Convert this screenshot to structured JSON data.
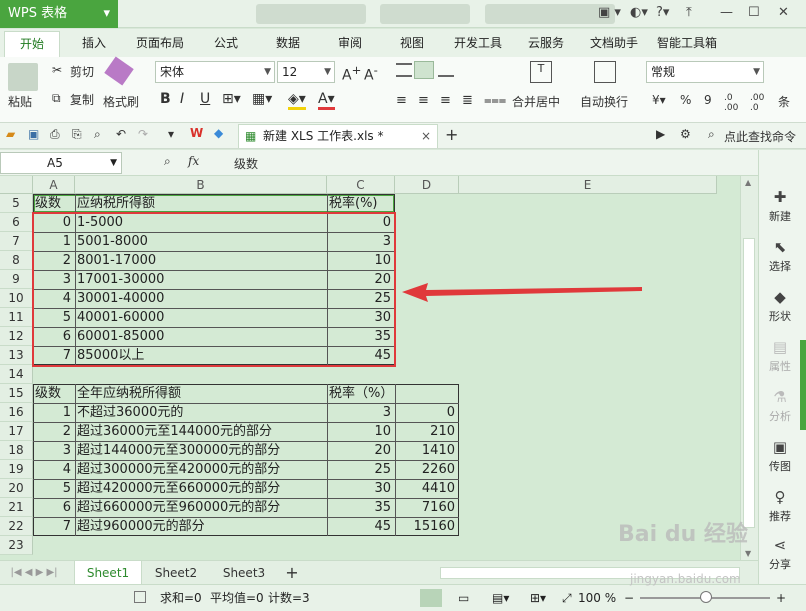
{
  "app": {
    "title": "WPS 表格",
    "title_dropdown": "▾"
  },
  "titlebar_icons": [
    "▣ ▾",
    "◐▾",
    "?▾",
    "⤒",
    "—",
    "☐",
    "✕"
  ],
  "menu": {
    "items": [
      "开始",
      "插入",
      "页面布局",
      "公式",
      "数据",
      "审阅",
      "视图",
      "开发工具",
      "云服务",
      "文档助手",
      "智能工具箱"
    ],
    "active": 0
  },
  "ribbon": {
    "paste": "粘贴",
    "cut": "剪切",
    "copy": "复制",
    "format_painter": "格式刷",
    "font": "宋体",
    "font_size": "12",
    "bold": "B",
    "italic": "I",
    "underline": "U",
    "merge": "合并居中",
    "wrap": "自动换行",
    "number_format": "常规",
    "percent": "%",
    "thousands": "9",
    "more": "条"
  },
  "quickbar": {
    "doc_tab": "新建 XLS 工作表.xls *",
    "search": "点此查找命令"
  },
  "formula": {
    "name_box": "A5",
    "fx": "fx",
    "content": "级数"
  },
  "columns": [
    "A",
    "B",
    "C",
    "D",
    "E"
  ],
  "rows": [
    "5",
    "6",
    "7",
    "8",
    "9",
    "10",
    "11",
    "12",
    "13",
    "14",
    "15",
    "16",
    "17",
    "18",
    "19",
    "20",
    "21",
    "22",
    "23"
  ],
  "table1": {
    "header": [
      "级数",
      "应纳税所得额",
      "税率(%)"
    ],
    "rows": [
      [
        "0",
        "1-5000",
        "0"
      ],
      [
        "1",
        "5001-8000",
        "3"
      ],
      [
        "2",
        "8001-17000",
        "10"
      ],
      [
        "3",
        "17001-30000",
        "20"
      ],
      [
        "4",
        "30001-40000",
        "25"
      ],
      [
        "5",
        "40001-60000",
        "30"
      ],
      [
        "6",
        "60001-85000",
        "35"
      ],
      [
        "7",
        "85000以上",
        "45"
      ]
    ]
  },
  "table2": {
    "header": [
      "级数",
      "全年应纳税所得额",
      "税率（%）"
    ],
    "rows": [
      [
        "1",
        "不超过36000元的",
        "3",
        "0"
      ],
      [
        "2",
        "超过36000元至144000元的部分",
        "10",
        "210"
      ],
      [
        "3",
        "超过144000元至300000元的部分",
        "20",
        "1410"
      ],
      [
        "4",
        "超过300000元至420000元的部分",
        "25",
        "2260"
      ],
      [
        "5",
        "超过420000元至660000元的部分",
        "30",
        "4410"
      ],
      [
        "6",
        "超过660000元至960000元的部分",
        "35",
        "7160"
      ],
      [
        "7",
        "超过960000元的部分",
        "45",
        "15160"
      ]
    ]
  },
  "right_panel": [
    {
      "label": "新建",
      "icon": "new-icon",
      "glyph": "✚"
    },
    {
      "label": "选择",
      "icon": "select-icon",
      "glyph": "⬉"
    },
    {
      "label": "形状",
      "icon": "shape-icon",
      "glyph": "◆"
    },
    {
      "label": "属性",
      "icon": "property-icon",
      "glyph": "▤"
    },
    {
      "label": "分析",
      "icon": "analysis-icon",
      "glyph": "⚗"
    },
    {
      "label": "传图",
      "icon": "upload-image-icon",
      "glyph": "▣"
    },
    {
      "label": "推荐",
      "icon": "recommend-icon",
      "glyph": "♀"
    },
    {
      "label": "分享",
      "icon": "share-icon",
      "glyph": "⋖"
    }
  ],
  "sheets": [
    "Sheet1",
    "Sheet2",
    "Sheet3"
  ],
  "add_sheet": "+",
  "status": {
    "sum": "求和=0",
    "avg": "平均值=0",
    "count": "计数=3",
    "zoom": "100 %"
  },
  "watermark": {
    "text": "Bai du 经验",
    "url": "jingyan.baidu.com"
  },
  "colors": {
    "accent": "#4aa53f",
    "annotation": "#e0393b"
  }
}
